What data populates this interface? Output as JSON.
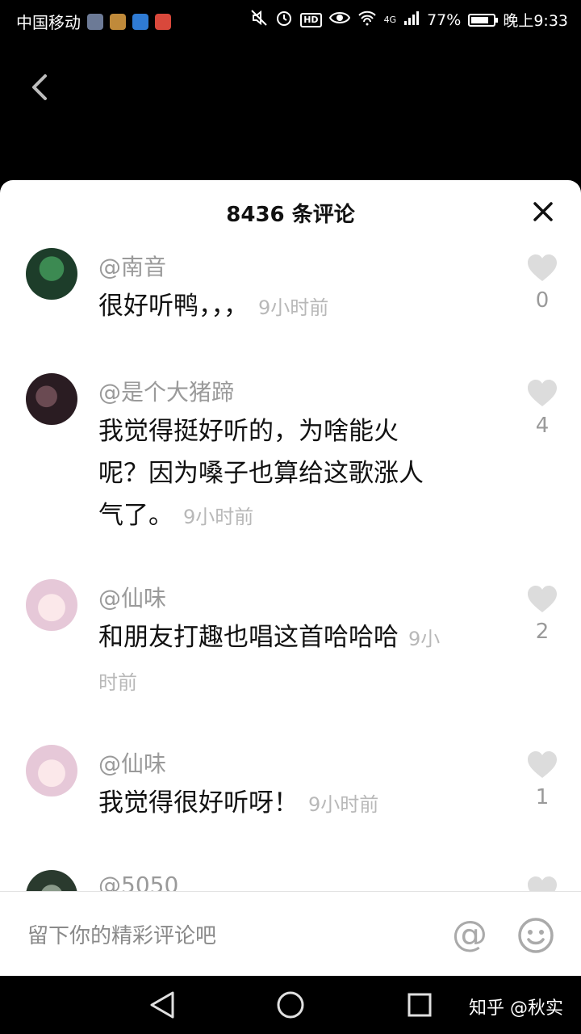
{
  "status_bar": {
    "carrier": "中国移动",
    "network": "4G",
    "badge": "HD",
    "battery": "77%",
    "time": "晚上9:33"
  },
  "sheet": {
    "title": "8436 条评论"
  },
  "comments": [
    {
      "user": "@南音",
      "text": "很好听鸭，，，",
      "time": "9小时前",
      "likes": "0"
    },
    {
      "user": "@是个大猪蹄",
      "text": "我觉得挺好听的，为啥能火呢？因为嗓子也算给这歌涨人气了。",
      "time": "9小时前",
      "likes": "4"
    },
    {
      "user": "@仙味",
      "text": "和朋友打趣也唱这首哈哈哈",
      "time": "9小时前",
      "likes": "2"
    },
    {
      "user": "@仙味",
      "text": "我觉得很好听呀！",
      "time": "9小时前",
      "likes": "1"
    },
    {
      "user": "@5050",
      "text": "",
      "time": "",
      "likes": ""
    }
  ],
  "input": {
    "placeholder": "留下你的精彩评论吧",
    "at_symbol": "@"
  },
  "watermark": "知乎 @秋实",
  "colors": {
    "like_heart": "#dcdcdc",
    "muted_text": "#9a9a9a",
    "sheet_bg": "#ffffff"
  }
}
